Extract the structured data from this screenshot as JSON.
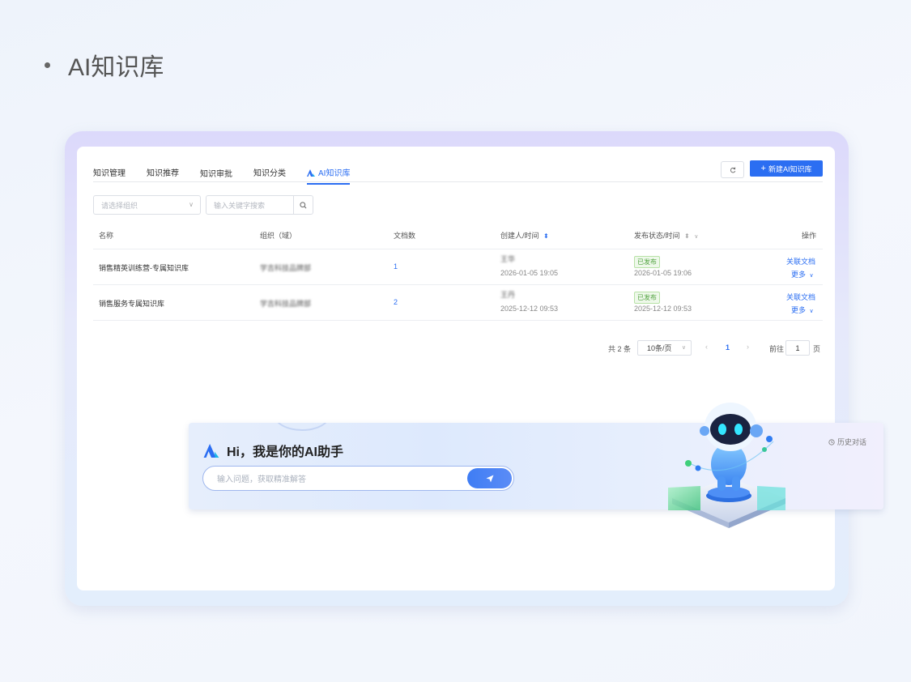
{
  "slide": {
    "title": "AI知识库"
  },
  "tabs": [
    {
      "label": "知识管理",
      "active": false
    },
    {
      "label": "知识推荐",
      "active": false
    },
    {
      "label": "知识审批",
      "active": false
    },
    {
      "label": "知识分类",
      "active": false
    },
    {
      "label": "AI知识库",
      "active": true
    }
  ],
  "toolbar": {
    "refresh_icon": "refresh-icon",
    "new_label": "新建AI知识库"
  },
  "filters": {
    "org_placeholder": "请选择组织",
    "keyword_placeholder": "输入关键字搜索"
  },
  "table": {
    "columns": [
      "名称",
      "组织（域）",
      "文档数",
      "创建人/时间",
      "发布状态/时间",
      "操作"
    ],
    "rows": [
      {
        "name": "销售精英训练营-专属知识库",
        "org": "学吉科技品牌部",
        "docs": "1",
        "creator": "王华",
        "created": "2026-01-05 19:05",
        "status": "已发布",
        "published": "2026-01-05 19:06",
        "action": "关联文档",
        "more": "更多"
      },
      {
        "name": "销售服务专属知识库",
        "org": "学吉科技品牌部",
        "docs": "2",
        "creator": "王丹",
        "created": "2025-12-12 09:53",
        "status": "已发布",
        "published": "2025-12-12 09:53",
        "action": "关联文档",
        "more": "更多"
      }
    ]
  },
  "pagination": {
    "total": "共 2 条",
    "page_size": "10条/页",
    "current": "1",
    "goto_prefix": "前往",
    "goto_value": "1",
    "goto_suffix": "页"
  },
  "assistant": {
    "title": "Hi，我是你的AI助手",
    "placeholder": "输入问题，获取精准解答",
    "history": "历史对话"
  },
  "colors": {
    "accent": "#2b6ef2",
    "success": "#52a340"
  }
}
